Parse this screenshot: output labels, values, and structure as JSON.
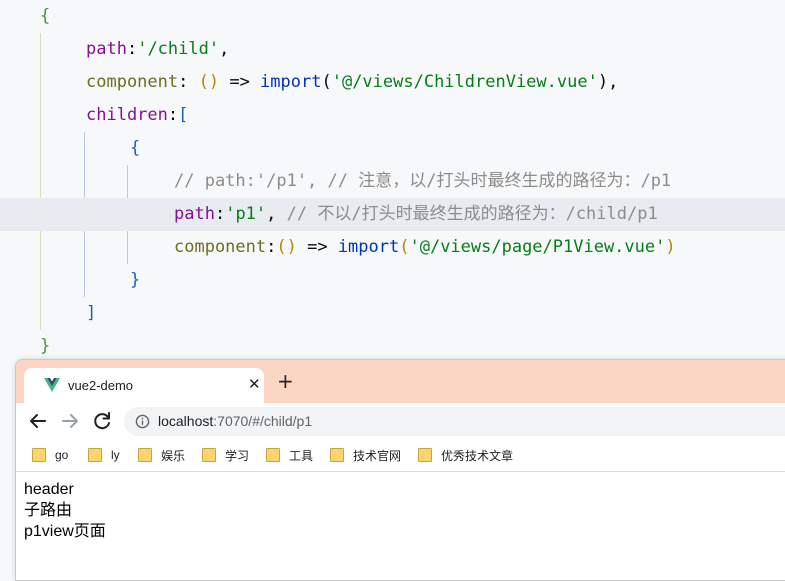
{
  "editor": {
    "lines": {
      "l1": {
        "open": "{"
      },
      "l2": {
        "key": "path",
        "colon": ":",
        "str": "'/child'",
        "comma": ","
      },
      "l3": {
        "key": "component",
        "colon": ": ",
        "paren": "()",
        "arrow": " => ",
        "fn": "import",
        "po": "(",
        "str": "'@/views/ChildrenView.vue'",
        "pc": ")",
        "comma": ","
      },
      "l4": {
        "key": "children",
        "colon": ":",
        "bracket": "["
      },
      "l5": {
        "open": "{"
      },
      "l6": {
        "comment": "// path:'/p1', // 注意，以/打头时最终生成的路径为：/p1"
      },
      "l7": {
        "key": "path",
        "colon": ":",
        "str": "'p1'",
        "comma": ", ",
        "comment": "// 不以/打头时最终生成的路径为：/child/p1"
      },
      "l8": {
        "key": "component",
        "colon": ":",
        "paren": "()",
        "arrow": " => ",
        "fn": "import",
        "po": "(",
        "str": "'@/views/page/P1View.vue'",
        "pc": ")"
      },
      "l9": {
        "close": "}"
      },
      "l10": {
        "close": "]"
      },
      "l11": {
        "close": "}"
      }
    }
  },
  "browser": {
    "tab": {
      "title": "vue2-demo",
      "close": "✕",
      "icon": "vue-logo-icon"
    },
    "new_tab": "+",
    "toolbar": {
      "back_icon": "arrow-left-icon",
      "forward_icon": "arrow-right-icon",
      "reload_icon": "reload-icon",
      "info_icon": "info-icon"
    },
    "url": {
      "host": "localhost",
      "path": ":7070/#/child/p1"
    },
    "bookmarks": [
      "go",
      "ly",
      "娱乐",
      "学习",
      "工具",
      "技术官网",
      "优秀技术文章"
    ],
    "page": {
      "line1": "header",
      "line2": "子路由",
      "line3": "p1view页面"
    }
  },
  "colors": {
    "tab_bar": "#fbd5c4",
    "vue_green": "#41b883",
    "vue_dark": "#35495e",
    "highlight_line": "#e8ecf0"
  }
}
